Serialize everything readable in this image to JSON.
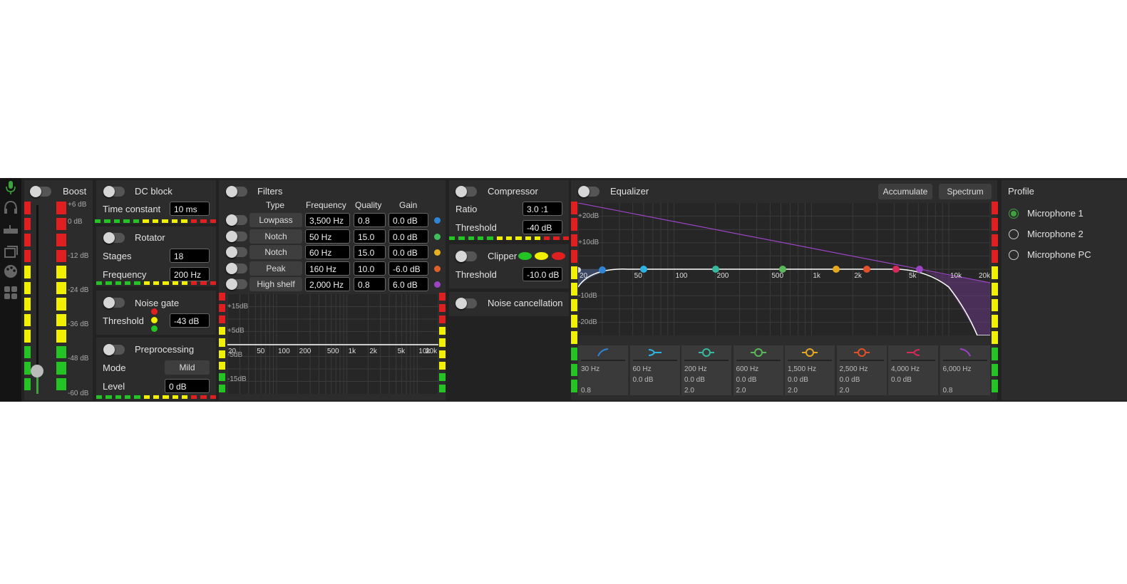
{
  "colors": {
    "accent": "#3ea23e",
    "led_green": "#24c424",
    "led_yellow": "#f0f000",
    "led_red": "#e02020",
    "panel": "#2c2c2c"
  },
  "nav": [
    "microphone-icon",
    "headphones-icon",
    "keyboard-icon",
    "windows-icon",
    "palette-icon",
    "grid-icon"
  ],
  "boost": {
    "label": "Boost",
    "scale": [
      "+6 dB",
      "0 dB",
      "-12 dB",
      "-24 dB",
      "-36 dB",
      "-48 dB",
      "-60 dB"
    ],
    "slider_level": 0.12
  },
  "dc_block": {
    "label": "DC block",
    "time_constant_label": "Time constant",
    "time_constant": "10 ms"
  },
  "rotator": {
    "label": "Rotator",
    "stages_label": "Stages",
    "stages": "18",
    "frequency_label": "Frequency",
    "frequency": "200 Hz"
  },
  "noise_gate": {
    "label": "Noise gate",
    "threshold_label": "Threshold",
    "threshold": "-43 dB"
  },
  "preprocessing": {
    "label": "Preprocessing",
    "mode_label": "Mode",
    "mode": "Mild",
    "level_label": "Level",
    "level": "0 dB"
  },
  "filters": {
    "label": "Filters",
    "headers": {
      "type": "Type",
      "frequency": "Frequency",
      "quality": "Quality",
      "gain": "Gain"
    },
    "rows": [
      {
        "type": "Lowpass",
        "frequency": "3,500 Hz",
        "quality": "0.8",
        "gain": "0.0 dB",
        "color": "#2f86d6"
      },
      {
        "type": "Notch",
        "frequency": "50 Hz",
        "quality": "15.0",
        "gain": "0.0 dB",
        "color": "#3fbf5a"
      },
      {
        "type": "Notch",
        "frequency": "60 Hz",
        "quality": "15.0",
        "gain": "0.0 dB",
        "color": "#e6b020"
      },
      {
        "type": "Peak",
        "frequency": "160 Hz",
        "quality": "10.0",
        "gain": "-6.0 dB",
        "color": "#e0602a"
      },
      {
        "type": "High shelf",
        "frequency": "2,000 Hz",
        "quality": "0.8",
        "gain": "6.0 dB",
        "color": "#9b44c4"
      }
    ],
    "graph": {
      "y_labels": [
        "+15dB",
        "+5dB",
        "-5dB",
        "-15dB"
      ],
      "x_labels": [
        "20",
        "50",
        "100",
        "200",
        "500",
        "1k",
        "2k",
        "5k",
        "10k",
        "20k"
      ]
    }
  },
  "compressor": {
    "label": "Compressor",
    "ratio_label": "Ratio",
    "ratio": "3.0 :1",
    "threshold_label": "Threshold",
    "threshold": "-40 dB"
  },
  "clipper": {
    "label": "Clipper",
    "threshold_label": "Threshold",
    "threshold": "-10.0 dB"
  },
  "noise_cancellation": {
    "label": "Noise cancellation"
  },
  "equalizer": {
    "label": "Equalizer",
    "accumulate_label": "Accumulate",
    "spectrum_label": "Spectrum",
    "y_labels": [
      "+20dB",
      "+10dB",
      "-10dB",
      "-20dB"
    ],
    "x_labels": [
      "20",
      "50",
      "100",
      "200",
      "500",
      "1k",
      "2k",
      "5k",
      "10k",
      "20k"
    ],
    "bands": [
      {
        "frequency": "30 Hz",
        "gain": "",
        "q": "0.8",
        "color": "#2f86d6"
      },
      {
        "frequency": "60 Hz",
        "gain": "0.0 dB",
        "q": "",
        "color": "#2fb2e0"
      },
      {
        "frequency": "200 Hz",
        "gain": "0.0 dB",
        "q": "2.0",
        "color": "#39b8a0"
      },
      {
        "frequency": "600 Hz",
        "gain": "0.0 dB",
        "q": "2.0",
        "color": "#5ab85a"
      },
      {
        "frequency": "1,500 Hz",
        "gain": "0.0 dB",
        "q": "2.0",
        "color": "#e6a820"
      },
      {
        "frequency": "2,500 Hz",
        "gain": "0.0 dB",
        "q": "2.0",
        "color": "#e0502a"
      },
      {
        "frequency": "4,000 Hz",
        "gain": "0.0 dB",
        "q": "",
        "color": "#d62a5a"
      },
      {
        "frequency": "6,000 Hz",
        "gain": "",
        "q": "0.8",
        "color": "#9b44c4"
      }
    ]
  },
  "profile": {
    "label": "Profile",
    "options": [
      "Microphone 1",
      "Microphone 2",
      "Microphone PC"
    ],
    "selected": "Microphone 1"
  }
}
